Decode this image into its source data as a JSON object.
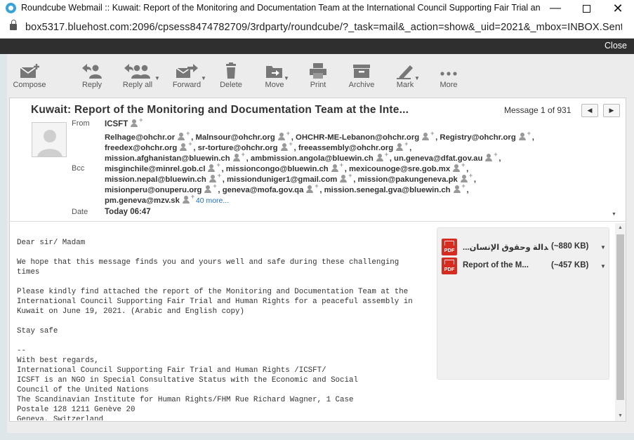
{
  "window": {
    "title": "Roundcube Webmail :: Kuwait: Report of the Monitoring and Documentation Team at the International Council Supporting Fair Trial and H...",
    "url": "box5317.bluehost.com:2096/cpsess8474782709/3rdparty/roundcube/?_task=mail&_action=show&_uid=2021&_mbox=INBOX.Sent&_e..."
  },
  "darkbar": {
    "close_label": "Close"
  },
  "toolbar": {
    "compose": "Compose",
    "reply": "Reply",
    "reply_all": "Reply all",
    "forward": "Forward",
    "delete": "Delete",
    "move": "Move",
    "print": "Print",
    "archive": "Archive",
    "mark": "Mark",
    "more": "More"
  },
  "message": {
    "subject": "Kuwait: Report of the Monitoring and Documentation Team at the Inte...",
    "counter": "Message 1 of 931",
    "from_label": "From",
    "from": "ICSFT",
    "recipients": [
      [
        "Relhage@ohchr.or",
        "Malnsour@ohchr.org",
        "OHCHR-ME-Lebanon@ohchr.org",
        "Registry@ohchr.org"
      ],
      [
        "freedex@ohchr.org",
        "sr-torture@ohchr.org",
        "freeassembly@ohchr.org"
      ],
      [
        "mission.afghanistan@bluewin.ch",
        "ambmission.angola@bluewin.ch",
        "un.geneva@dfat.gov.au"
      ],
      [
        "misginchile@minrel.gob.cl",
        "missioncongo@bluewin.ch",
        "mexicounoge@sre.gob.mx"
      ],
      [
        "mission.nepal@bluewin.ch",
        "missionduniger1@gmail.com",
        "mission@pakungeneva.pk"
      ],
      [
        "misionperu@onuperu.org",
        "geneva@mofa.gov.qa",
        "mission.senegal.gva@bluewin.ch"
      ],
      [
        "pm.geneva@mzv.sk"
      ]
    ],
    "more_link": "40 more...",
    "bcc_label": "Bcc",
    "date_label": "Date",
    "date": "Today 06:47"
  },
  "body": {
    "text": "Dear sir/ Madam\n\nWe hope that this message finds you and yours well and safe during these challenging\ntimes\n\nPlease kindly find attached the report of the Monitoring and Documentation Team at the\nInternational Council Supporting Fair Trial and Human Rights for a peaceful assembly in\nKuwait on June 19, 2021. (Arabic and English copy)\n\nStay safe\n\n--\nWith best regards,\nInternational Council Supporting Fair Trial and Human Rights /ICSFT/\nICSFT is an NGO in Special Consultative Status with the Economic and Social\nCouncil of the United Nations\nThe Scandinavian Institute for Human Rights/FHM Rue Richard Wagner, 1 Case\nPostale 128 1211 Genève 20\nGeneva, Switzerland"
  },
  "attachments": [
    {
      "name": "...لجنة العدالة وحقوق الإنسان",
      "size": "(~880 KB)",
      "type": "PDF"
    },
    {
      "name": "Report of the M...",
      "size": "(~457 KB)",
      "type": "PDF"
    }
  ],
  "colors": {
    "accent": "#1e6db7",
    "pdf": "#d62b1f",
    "darkbar": "#2f2f2f"
  }
}
